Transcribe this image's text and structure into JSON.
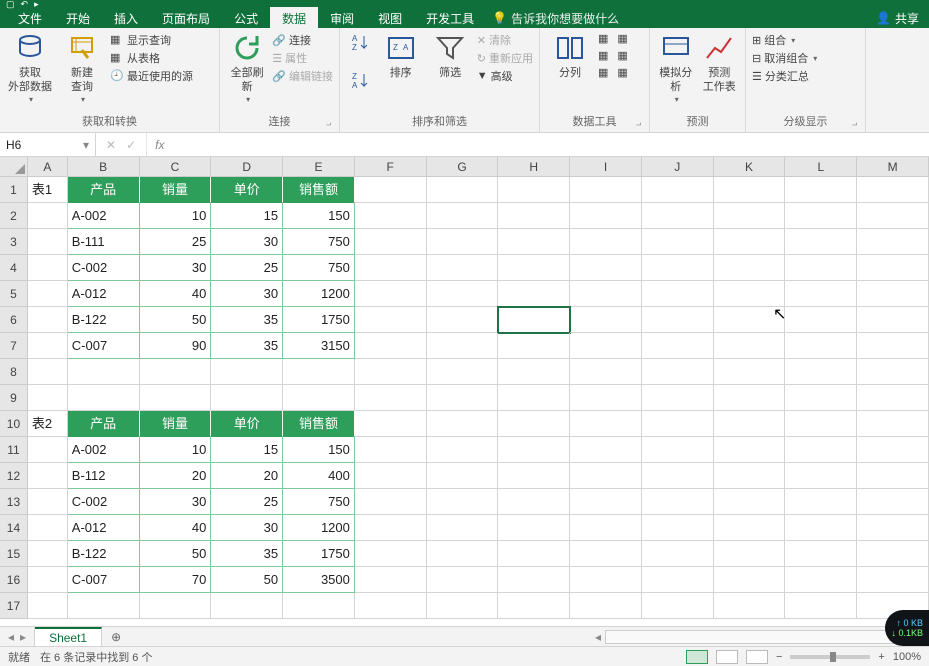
{
  "tabs": {
    "file": "文件",
    "home": "开始",
    "insert": "插入",
    "layout": "页面布局",
    "formula": "公式",
    "data": "数据",
    "review": "审阅",
    "view": "视图",
    "dev": "开发工具",
    "tellme": "告诉我你想要做什么",
    "share": "共享"
  },
  "ribbon": {
    "g1": {
      "btn1": "获取\n外部数据",
      "label": "获取和转换",
      "btn2": "新建\n查询",
      "i1": "显示查询",
      "i2": "从表格",
      "i3": "最近使用的源"
    },
    "g2": {
      "btn": "全部刷新",
      "i1": "连接",
      "i2": "属性",
      "i3": "编辑链接",
      "label": "连接"
    },
    "g3": {
      "btn": "排序",
      "btn2": "筛选",
      "i1": "清除",
      "i2": "重新应用",
      "i3": "高级",
      "label": "排序和筛选"
    },
    "g4": {
      "btn": "分列",
      "label": "数据工具"
    },
    "g5": {
      "btn1": "模拟分析",
      "btn2": "预测\n工作表",
      "label": "预测"
    },
    "g6": {
      "i1": "组合",
      "i2": "取消组合",
      "i3": "分类汇总",
      "label": "分级显示"
    }
  },
  "namebox": "H6",
  "columns": [
    "A",
    "B",
    "C",
    "D",
    "E",
    "F",
    "G",
    "H",
    "I",
    "J",
    "K",
    "L",
    "M"
  ],
  "rows": [
    "1",
    "2",
    "3",
    "4",
    "5",
    "6",
    "7",
    "8",
    "9",
    "10",
    "11",
    "12",
    "13",
    "14",
    "15",
    "16",
    "17"
  ],
  "a1": "表1",
  "a10": "表2",
  "headers": {
    "p": "产品",
    "q": "销量",
    "u": "单价",
    "s": "销售额"
  },
  "chart_data": [
    {
      "type": "table",
      "title": "表1",
      "columns": [
        "产品",
        "销量",
        "单价",
        "销售额"
      ],
      "rows": [
        [
          "A-002",
          10,
          15,
          150
        ],
        [
          "B-111",
          25,
          30,
          750
        ],
        [
          "C-002",
          30,
          25,
          750
        ],
        [
          "A-012",
          40,
          30,
          1200
        ],
        [
          "B-122",
          50,
          35,
          1750
        ],
        [
          "C-007",
          90,
          35,
          3150
        ]
      ]
    },
    {
      "type": "table",
      "title": "表2",
      "columns": [
        "产品",
        "销量",
        "单价",
        "销售额"
      ],
      "rows": [
        [
          "A-002",
          10,
          15,
          150
        ],
        [
          "B-112",
          20,
          20,
          400
        ],
        [
          "C-002",
          30,
          25,
          750
        ],
        [
          "A-012",
          40,
          30,
          1200
        ],
        [
          "B-122",
          50,
          35,
          1750
        ],
        [
          "C-007",
          70,
          50,
          3500
        ]
      ]
    }
  ],
  "sheet": "Sheet1",
  "status": {
    "ready": "就绪",
    "filter": "在 6 条记录中找到 6 个",
    "zoom": "100%",
    "net1": "0 KB",
    "net2": "0.1KB"
  }
}
